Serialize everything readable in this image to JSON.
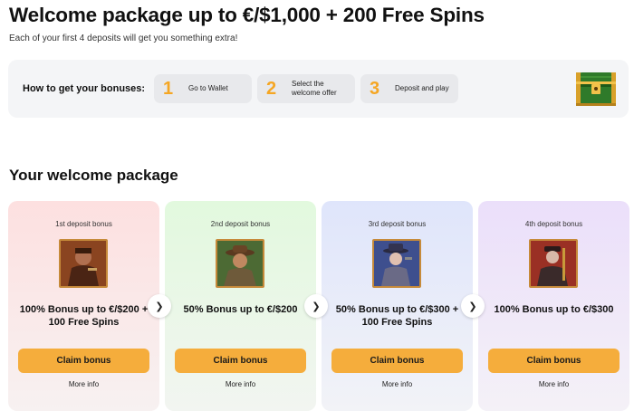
{
  "header": {
    "title": "Welcome package up to €/$1,000 + 200 Free Spins",
    "subtitle": "Each of your first 4 deposits will get you something extra!"
  },
  "how_to": {
    "label": "How to get your bonuses:",
    "steps": [
      {
        "num": "1",
        "text": "Go to Wallet"
      },
      {
        "num": "2",
        "text": "Select the welcome offer"
      },
      {
        "num": "3",
        "text": "Deposit and play"
      }
    ],
    "icon": "treasure-chest-icon"
  },
  "package": {
    "title": "Your welcome package",
    "cards": [
      {
        "label": "1st deposit bonus",
        "offer": "100% Bonus up to €/$200 + 100 Free Spins",
        "button": "Claim bonus",
        "more": "More info",
        "color": "#fde0e0"
      },
      {
        "label": "2nd deposit bonus",
        "offer": "50% Bonus up to €/$200",
        "button": "Claim bonus",
        "more": "More info",
        "color": "#e2f9de"
      },
      {
        "label": "3rd deposit bonus",
        "offer": "50% Bonus up to €/$300 + 100 Free Spins",
        "button": "Claim bonus",
        "more": "More info",
        "color": "#dfe5fb"
      },
      {
        "label": "4th deposit bonus",
        "offer": "100% Bonus up to €/$300",
        "button": "Claim bonus",
        "more": "More info",
        "color": "#ebdffa"
      }
    ],
    "accent": "#f5ad3c",
    "arrow_icon": "chevron-right-icon"
  }
}
